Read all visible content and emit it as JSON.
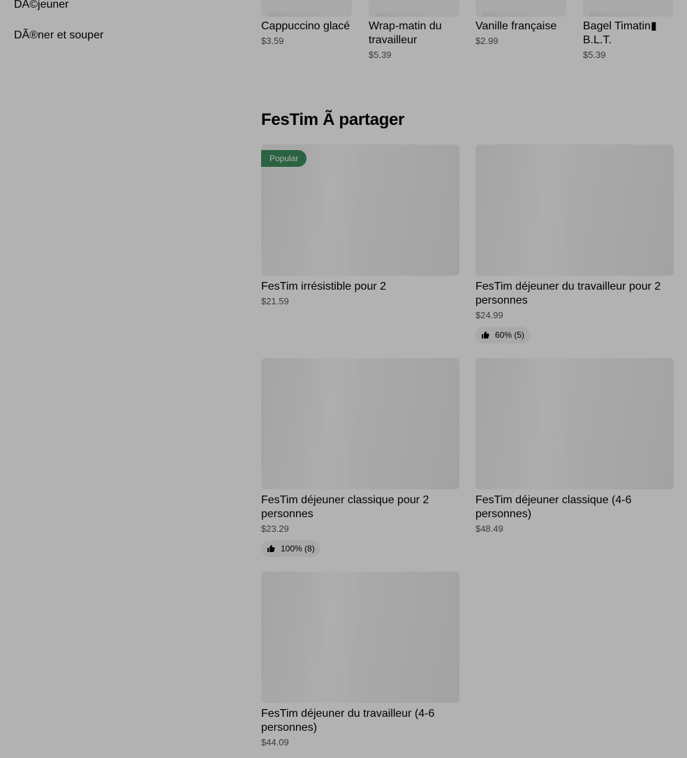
{
  "sidebar": {
    "items": [
      {
        "label": "DÃ©jeuner"
      },
      {
        "label": "DÃ®ner et souper"
      }
    ]
  },
  "top_items": [
    {
      "name": "Cappuccino glacé",
      "price": "$3.59"
    },
    {
      "name": "Wrap-matin du travailleur",
      "price": "$5.39"
    },
    {
      "name": "Vanille française",
      "price": "$2.99"
    },
    {
      "name": "Bagel Timatin▮ B.L.T.",
      "price": "$5.39"
    }
  ],
  "section": {
    "title": "FesTim Ã  partager"
  },
  "cards": [
    {
      "name": "FesTim irrésistible pour 2",
      "price": "$21.59",
      "badge": "Popular"
    },
    {
      "name": "FesTim déjeuner du travailleur pour 2 personnes",
      "price": "$24.99",
      "rating": "60% (5)"
    },
    {
      "name": "FesTim déjeuner classique pour 2 personnes",
      "price": "$23.29",
      "rating": "100% (8)"
    },
    {
      "name": "FesTim déjeuner classique (4-6 personnes)",
      "price": "$48.49"
    },
    {
      "name": "FesTim déjeuner du travailleur (4-6 personnes)",
      "price": "$44.09"
    }
  ],
  "icons": {
    "rating": "thumbs-up-icon"
  },
  "colors": {
    "badge_bg": "#3e8e5f",
    "overlay": "rgba(0,0,0,0.30)"
  }
}
